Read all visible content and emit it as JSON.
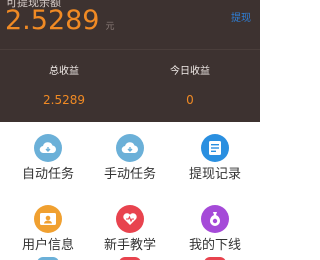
{
  "balance": {
    "label": "可提现余额",
    "value": "2.5289",
    "unit": "元",
    "withdraw_link": "提现"
  },
  "stats": {
    "total_label": "总收益",
    "total_value": "2.5289",
    "today_label": "今日收益",
    "today_value": "0"
  },
  "menu": [
    {
      "label": "自动任务",
      "icon": "cloud-icon",
      "color": "#6bb0d8"
    },
    {
      "label": "手动任务",
      "icon": "cloud-icon",
      "color": "#6bb0d8"
    },
    {
      "label": "提现记录",
      "icon": "list-icon",
      "color": "#2a8fe0"
    },
    {
      "label": "用户信息",
      "icon": "id-card-icon",
      "color": "#f0a030"
    },
    {
      "label": "新手教学",
      "icon": "heart-icon",
      "color": "#e8434e"
    },
    {
      "label": "我的下线",
      "icon": "money-bag-icon",
      "color": "#a54ad8"
    }
  ],
  "colors": {
    "header_bg": "#3d3230",
    "accent": "#f08a24",
    "link": "#2f7fd6"
  }
}
